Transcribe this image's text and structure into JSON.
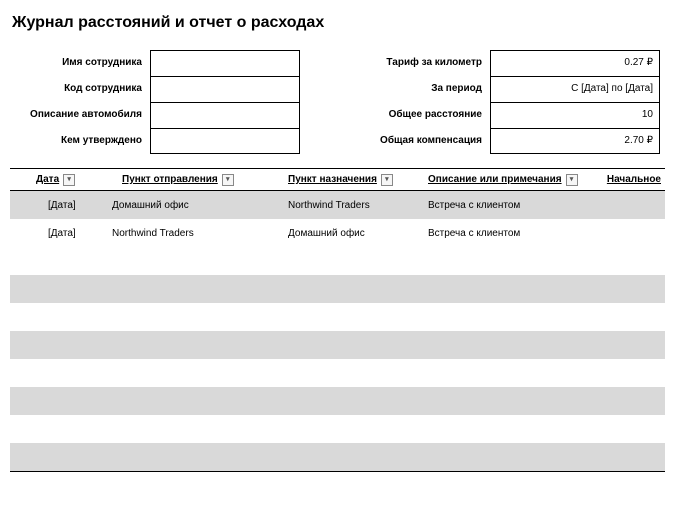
{
  "title": "Журнал расстояний и отчет о расходах",
  "left_fields": [
    {
      "label": "Имя сотрудника",
      "value": ""
    },
    {
      "label": "Код сотрудника",
      "value": ""
    },
    {
      "label": "Описание автомобиля",
      "value": ""
    },
    {
      "label": "Кем утверждено",
      "value": ""
    }
  ],
  "right_fields": [
    {
      "label": "Тариф за километр",
      "value": "0.27 ₽"
    },
    {
      "label": "За период",
      "value": "С [Дата] по [Дата]"
    },
    {
      "label": "Общее расстояние",
      "value": "10"
    },
    {
      "label": "Общая компенсация",
      "value": "2.70 ₽"
    }
  ],
  "columns": {
    "date": "Дата",
    "from": "Пункт отправления",
    "to": "Пункт назначения",
    "desc": "Описание или примечания",
    "start": "Начальное"
  },
  "rows": [
    {
      "date": "[Дата]",
      "from": "Домашний офис",
      "to": "Northwind Traders",
      "desc": "Встреча с клиентом"
    },
    {
      "date": "[Дата]",
      "from": "Northwind Traders",
      "to": "Домашний офис",
      "desc": "Встреча с клиентом"
    }
  ]
}
